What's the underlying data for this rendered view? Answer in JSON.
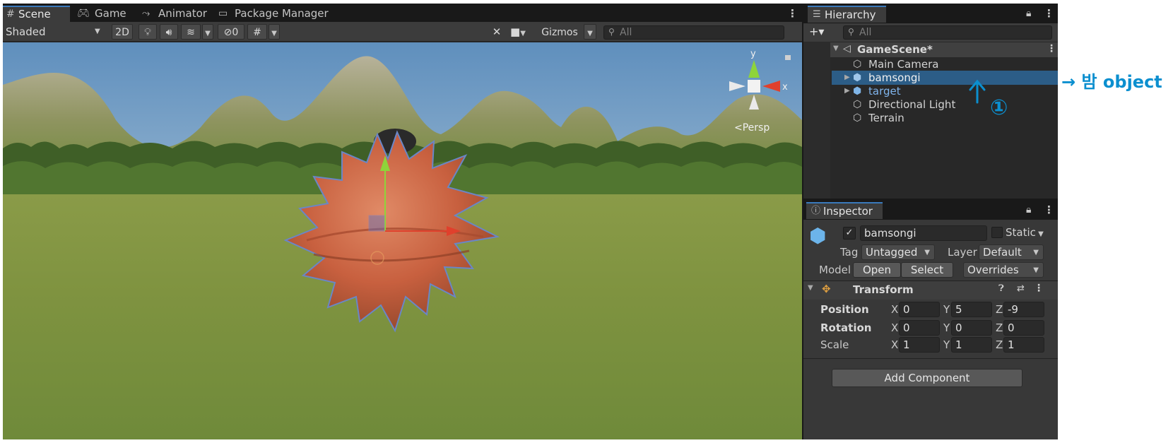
{
  "scene": {
    "tabs": [
      {
        "label": "Scene",
        "icon": "grid-icon"
      },
      {
        "label": "Game",
        "icon": "gamepad-icon"
      },
      {
        "label": "Animator",
        "icon": "animator-icon"
      },
      {
        "label": "Package Manager",
        "icon": "package-icon"
      }
    ],
    "toolbar": {
      "shading_mode": "Shaded",
      "mode_2d": "2D",
      "hidden_count": "0",
      "gizmos_label": "Gizmos",
      "search_placeholder": "All"
    },
    "gizmo": {
      "y_label": "y",
      "x_label": "x",
      "projection_label": "<Persp"
    }
  },
  "hierarchy": {
    "tab_label": "Hierarchy",
    "add_label": "+▾",
    "search_placeholder": "All",
    "scene_name": "GameScene*",
    "items": [
      {
        "label": "Main Camera",
        "icon": "cube-outline-icon",
        "selected": false
      },
      {
        "label": "bamsongi",
        "icon": "prefab-cube-icon",
        "selected": true
      },
      {
        "label": "target",
        "icon": "prefab-cube-icon",
        "selected": false
      },
      {
        "label": "Directional Light",
        "icon": "cube-outline-icon",
        "selected": false
      },
      {
        "label": "Terrain",
        "icon": "cube-outline-icon",
        "selected": false
      }
    ]
  },
  "inspector": {
    "tab_label": "Inspector",
    "object_name": "bamsongi",
    "static_label": "Static",
    "tag_label": "Tag",
    "tag_value": "Untagged",
    "layer_label": "Layer",
    "layer_value": "Default",
    "model_label": "Model",
    "open_label": "Open",
    "select_label": "Select",
    "overrides_label": "Overrides",
    "transform": {
      "title": "Transform",
      "position_label": "Position",
      "rotation_label": "Rotation",
      "scale_label": "Scale",
      "position": {
        "x": "0",
        "y": "5",
        "z": "-9"
      },
      "rotation": {
        "x": "0",
        "y": "0",
        "z": "0"
      },
      "scale": {
        "x": "1",
        "y": "1",
        "z": "1"
      },
      "axis_x": "X",
      "axis_y": "Y",
      "axis_z": "Z"
    },
    "add_component_label": "Add Component"
  },
  "annotation": {
    "text": "→ 밤 object",
    "marker": "①"
  },
  "colors": {
    "selection": "#2c5d87",
    "accent_tab": "#3a79bb",
    "annotation": "#0b8fcf",
    "bamsongi": "#c8603f"
  }
}
